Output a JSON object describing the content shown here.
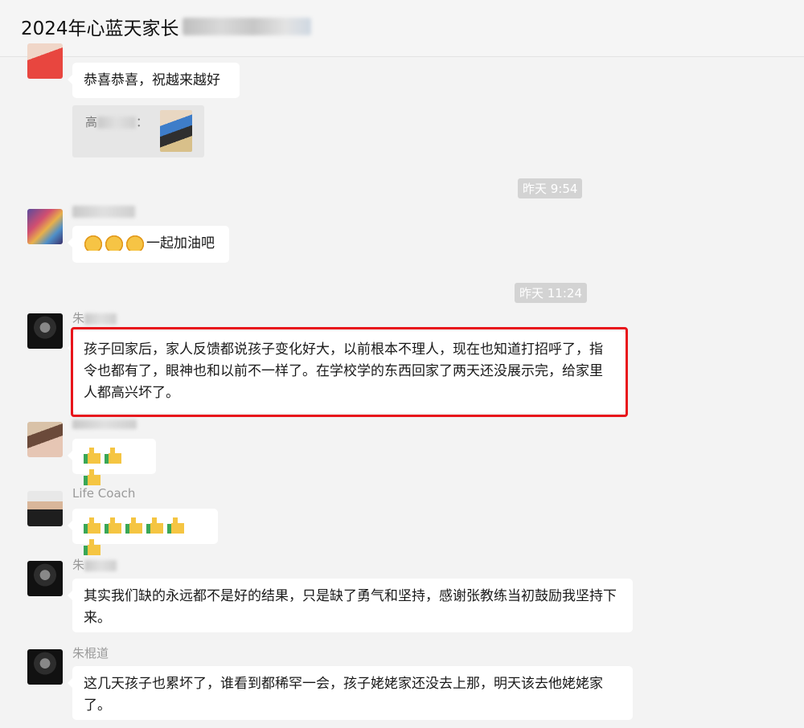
{
  "header": {
    "title": "2024年心蓝天家长"
  },
  "messages": [
    {
      "text": "恭喜恭喜，祝越来越好"
    },
    {
      "quote": {
        "prefix": "高",
        "suffix": "："
      }
    },
    {
      "time": "昨天 9:54"
    },
    {
      "text": "一起加油吧",
      "emoji": "handshake-icon"
    },
    {
      "time": "昨天 11:24"
    },
    {
      "nick_prefix": "朱",
      "text": "孩子回家后，家人反馈都说孩子变化好大，以前根本不理人，现在也知道打招呼了，指令也都有了，眼神也和以前不一样了。在学校学的东西回家了两天还没展示完，给家里人都高兴坏了。"
    },
    {
      "emoji": "thumbs-up-icon",
      "count": 3
    },
    {
      "nick": "Life Coach",
      "emoji": "thumbs-up-icon",
      "count": 6
    },
    {
      "nick_prefix": "朱",
      "text": "其实我们缺的永远都不是好的结果，只是缺了勇气和坚持，感谢张教练当初鼓励我坚持下来。"
    },
    {
      "nick": "朱棍道",
      "text": "这几天孩子也累坏了，谁看到都稀罕一会，孩子姥姥家还没去上那，明天该去他姥姥家了。"
    }
  ],
  "colors": {
    "highlight": "#e8141b",
    "background": "#f3f3f3",
    "bubble": "#ffffff"
  }
}
